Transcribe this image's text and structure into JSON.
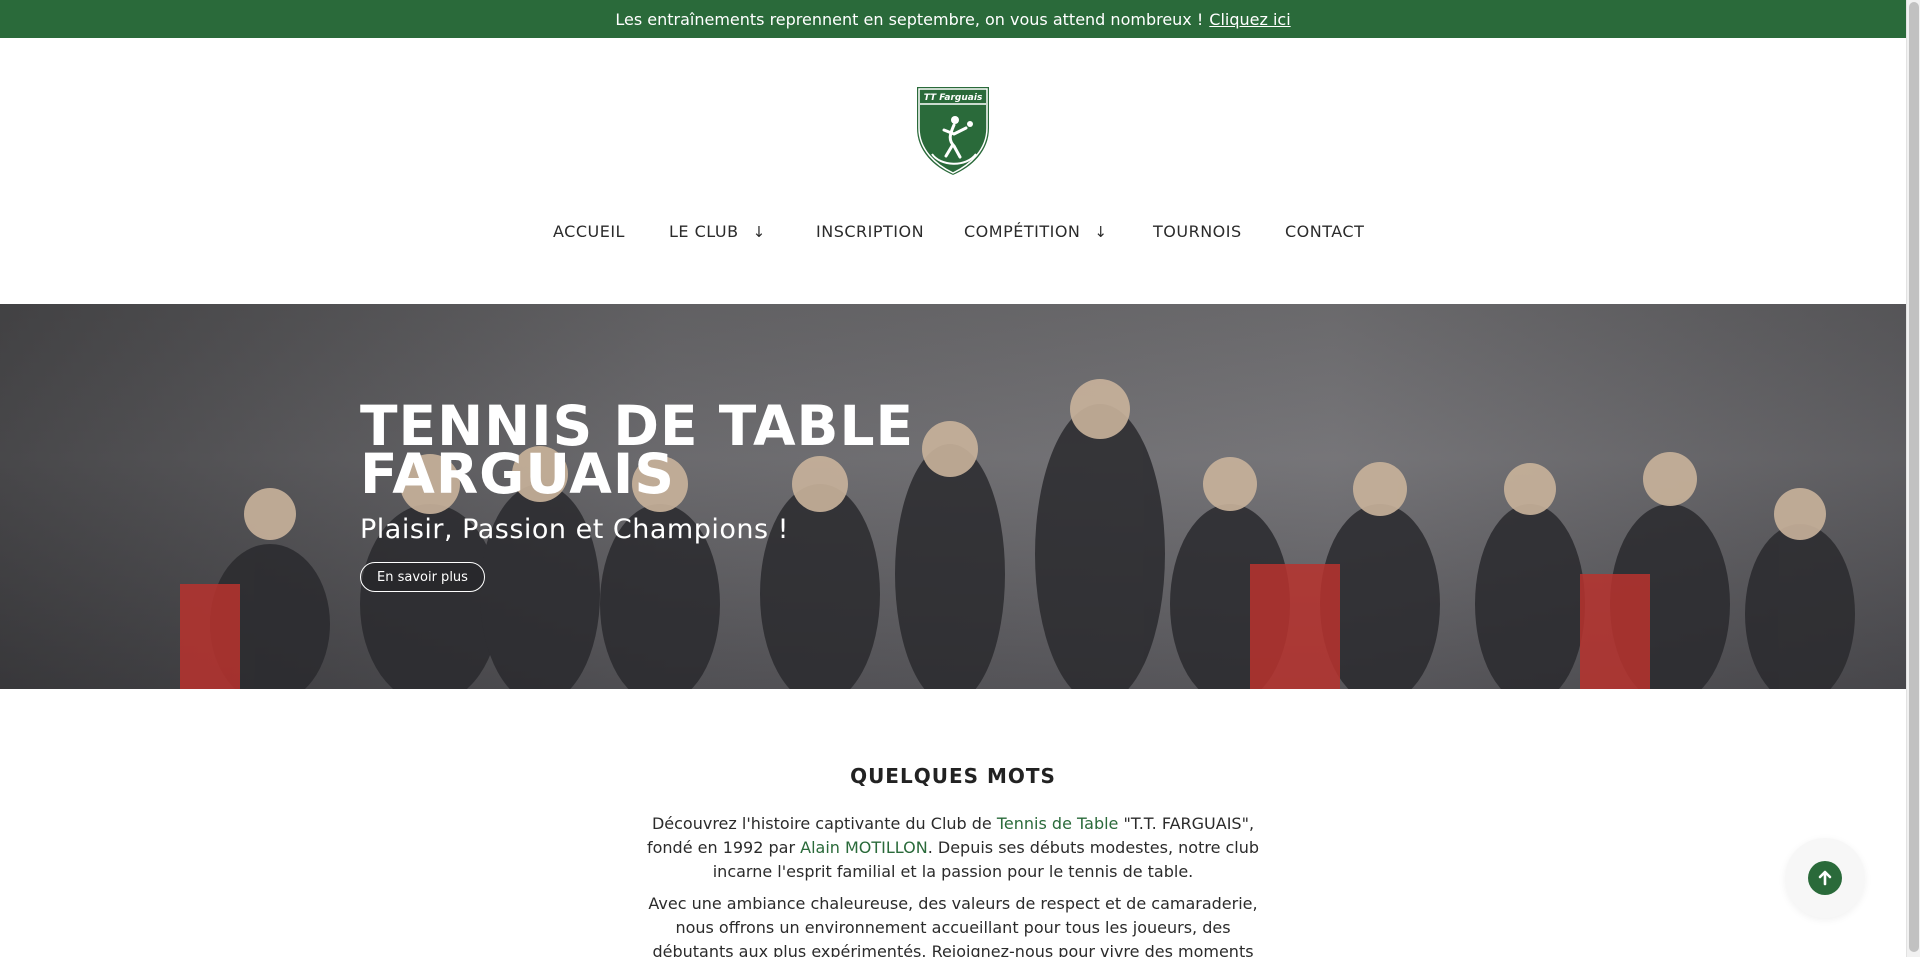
{
  "announcement": {
    "text": "Les entraînements reprennent en septembre, on vous attend nombreux !",
    "link": "Cliquez ici"
  },
  "logo": {
    "text": "TT Farguais",
    "icon": "table-tennis-shield-icon"
  },
  "nav": {
    "items": [
      {
        "label": "ACCUEIL"
      },
      {
        "label": "LE CLUB",
        "icon": "arrow-down-icon"
      },
      {
        "label": "INSCRIPTION"
      },
      {
        "label": "COMPÉTITION",
        "icon": "arrow-down-icon"
      },
      {
        "label": "TOURNOIS"
      },
      {
        "label": "CONTACT"
      }
    ]
  },
  "hero": {
    "title": "TENNIS DE TABLE FARGUAIS",
    "subtitle": "Plaisir, Passion et Champions !",
    "button": "En savoir plus"
  },
  "about": {
    "title": "QUELQUES MOTS",
    "p1_a": "Découvrez l'histoire captivante du Club de",
    "p1_link": "Tennis de Table",
    "p1_b": "\"T.T. FARGUAIS\", fondé en 1992 par",
    "p1_name": "Alain MOTILLON",
    "p1_c": ". Depuis ses débuts modestes, notre club incarne l'esprit familial et la passion pour le tennis de table.",
    "p2": "Avec une ambiance chaleureuse, des valeurs de respect et de camaraderie, nous offrons un environnement accueillant pour tous les joueurs, des débutants aux plus expérimentés. Rejoignez-nous pour vivre des moments uniques et partager votre"
  },
  "colors": {
    "brand": "#2a6a3a",
    "white": "#ffffff",
    "text": "#2b2b2b"
  },
  "scroll_top": {
    "icon": "arrow-up-icon"
  }
}
